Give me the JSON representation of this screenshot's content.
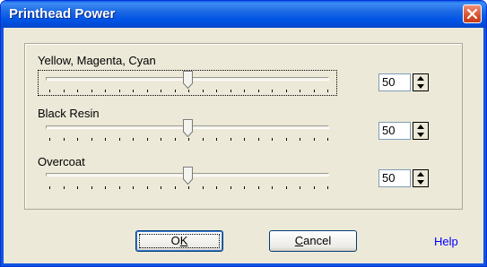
{
  "window": {
    "title": "Printhead Power"
  },
  "sliders": [
    {
      "label": "Yellow, Magenta, Cyan",
      "value": "50",
      "level": 50,
      "focused": true
    },
    {
      "label": "Black Resin",
      "value": "50",
      "level": 50,
      "focused": false
    },
    {
      "label": "Overcoat",
      "value": "50",
      "level": 50,
      "focused": false
    }
  ],
  "buttons": {
    "ok_label": "OK",
    "cancel_label": "Cancel",
    "help_label": "Help"
  },
  "icons": {
    "close": "close-icon",
    "spin_up": "arrow-up-icon",
    "spin_down": "arrow-down-icon"
  },
  "colors": {
    "titlebar": "#0055e5",
    "close_button": "#d8532e",
    "help_link": "#0000ff"
  }
}
